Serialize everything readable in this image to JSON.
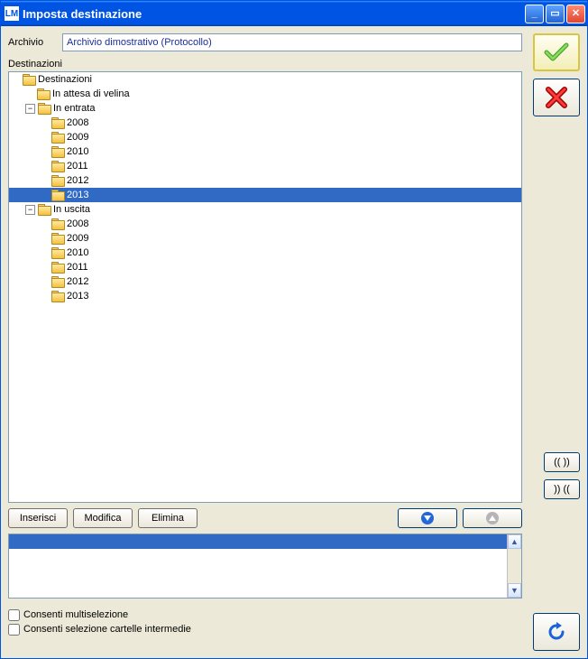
{
  "window": {
    "title": "Imposta destinazione",
    "app_icon_text": "LM"
  },
  "archivio": {
    "label": "Archivio",
    "value": "Archivio dimostrativo (Protocollo)"
  },
  "destinazioni": {
    "label": "Destinazioni"
  },
  "tree": [
    {
      "indent": 0,
      "toggle": "",
      "label": "Destinazioni",
      "selected": false
    },
    {
      "indent": 1,
      "toggle": "",
      "label": "In attesa di velina",
      "selected": false
    },
    {
      "indent": 1,
      "toggle": "-",
      "label": "In entrata",
      "selected": false
    },
    {
      "indent": 2,
      "toggle": "",
      "label": "2008",
      "selected": false
    },
    {
      "indent": 2,
      "toggle": "",
      "label": "2009",
      "selected": false
    },
    {
      "indent": 2,
      "toggle": "",
      "label": "2010",
      "selected": false
    },
    {
      "indent": 2,
      "toggle": "",
      "label": "2011",
      "selected": false
    },
    {
      "indent": 2,
      "toggle": "",
      "label": "2012",
      "selected": false
    },
    {
      "indent": 2,
      "toggle": "",
      "label": "2013",
      "selected": true
    },
    {
      "indent": 1,
      "toggle": "-",
      "label": "In uscita",
      "selected": false
    },
    {
      "indent": 2,
      "toggle": "",
      "label": "2008",
      "selected": false
    },
    {
      "indent": 2,
      "toggle": "",
      "label": "2009",
      "selected": false
    },
    {
      "indent": 2,
      "toggle": "",
      "label": "2010",
      "selected": false
    },
    {
      "indent": 2,
      "toggle": "",
      "label": "2011",
      "selected": false
    },
    {
      "indent": 2,
      "toggle": "",
      "label": "2012",
      "selected": false
    },
    {
      "indent": 2,
      "toggle": "",
      "label": "2013",
      "selected": false
    }
  ],
  "buttons": {
    "insert": "Inserisci",
    "modify": "Modifica",
    "delete": "Elimina"
  },
  "side_small": {
    "expand": "(( ))",
    ")collapse(": ")) (("
  },
  "checks": {
    "multi": "Consenti multiselezione",
    "intermedie": "Consenti selezione cartelle intermedie"
  }
}
